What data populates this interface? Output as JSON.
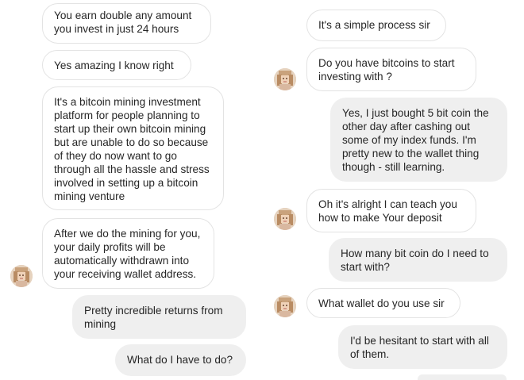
{
  "left_conversation": {
    "messages": [
      {
        "sender": "them",
        "text": "You earn double any amount you invest in just 24 hours"
      },
      {
        "sender": "them",
        "text": "Yes amazing I know right"
      },
      {
        "sender": "them",
        "text": "It's a bitcoin mining investment platform for people planning to start up their own bitcoin mining but are unable to do so because of they do now want to go through all the hassle and stress involved in setting up a bitcoin mining venture"
      },
      {
        "sender": "them",
        "text": "After we do the mining for you, your daily profits will be automatically withdrawn into your receiving wallet address."
      },
      {
        "sender": "me",
        "text": "Pretty incredible returns from mining"
      },
      {
        "sender": "me",
        "text": "What do I have to do?"
      }
    ]
  },
  "right_conversation": {
    "messages": [
      {
        "sender": "them",
        "text": "It's a simple process sir"
      },
      {
        "sender": "them",
        "text": "Do you have bitcoins to start investing with ?"
      },
      {
        "sender": "me",
        "text": "Yes, I just bought 5 bit coin the other day after cashing out some of my index funds. I'm pretty new to the wallet thing though - still learning."
      },
      {
        "sender": "them",
        "text": "Oh it's alright I can teach you how to make Your deposit"
      },
      {
        "sender": "me",
        "text": "How many bit coin do I need to start with?"
      },
      {
        "sender": "them",
        "text": "What wallet do you use sir"
      },
      {
        "sender": "me",
        "text": "I'd be hesitant to start with all of them."
      }
    ]
  },
  "colors": {
    "incoming_bg": "#ffffff",
    "incoming_border": "#e3e3e3",
    "outgoing_bg": "#efefef",
    "text": "#262626"
  },
  "icons": {
    "avatar": "pixelated-profile-avatar"
  }
}
